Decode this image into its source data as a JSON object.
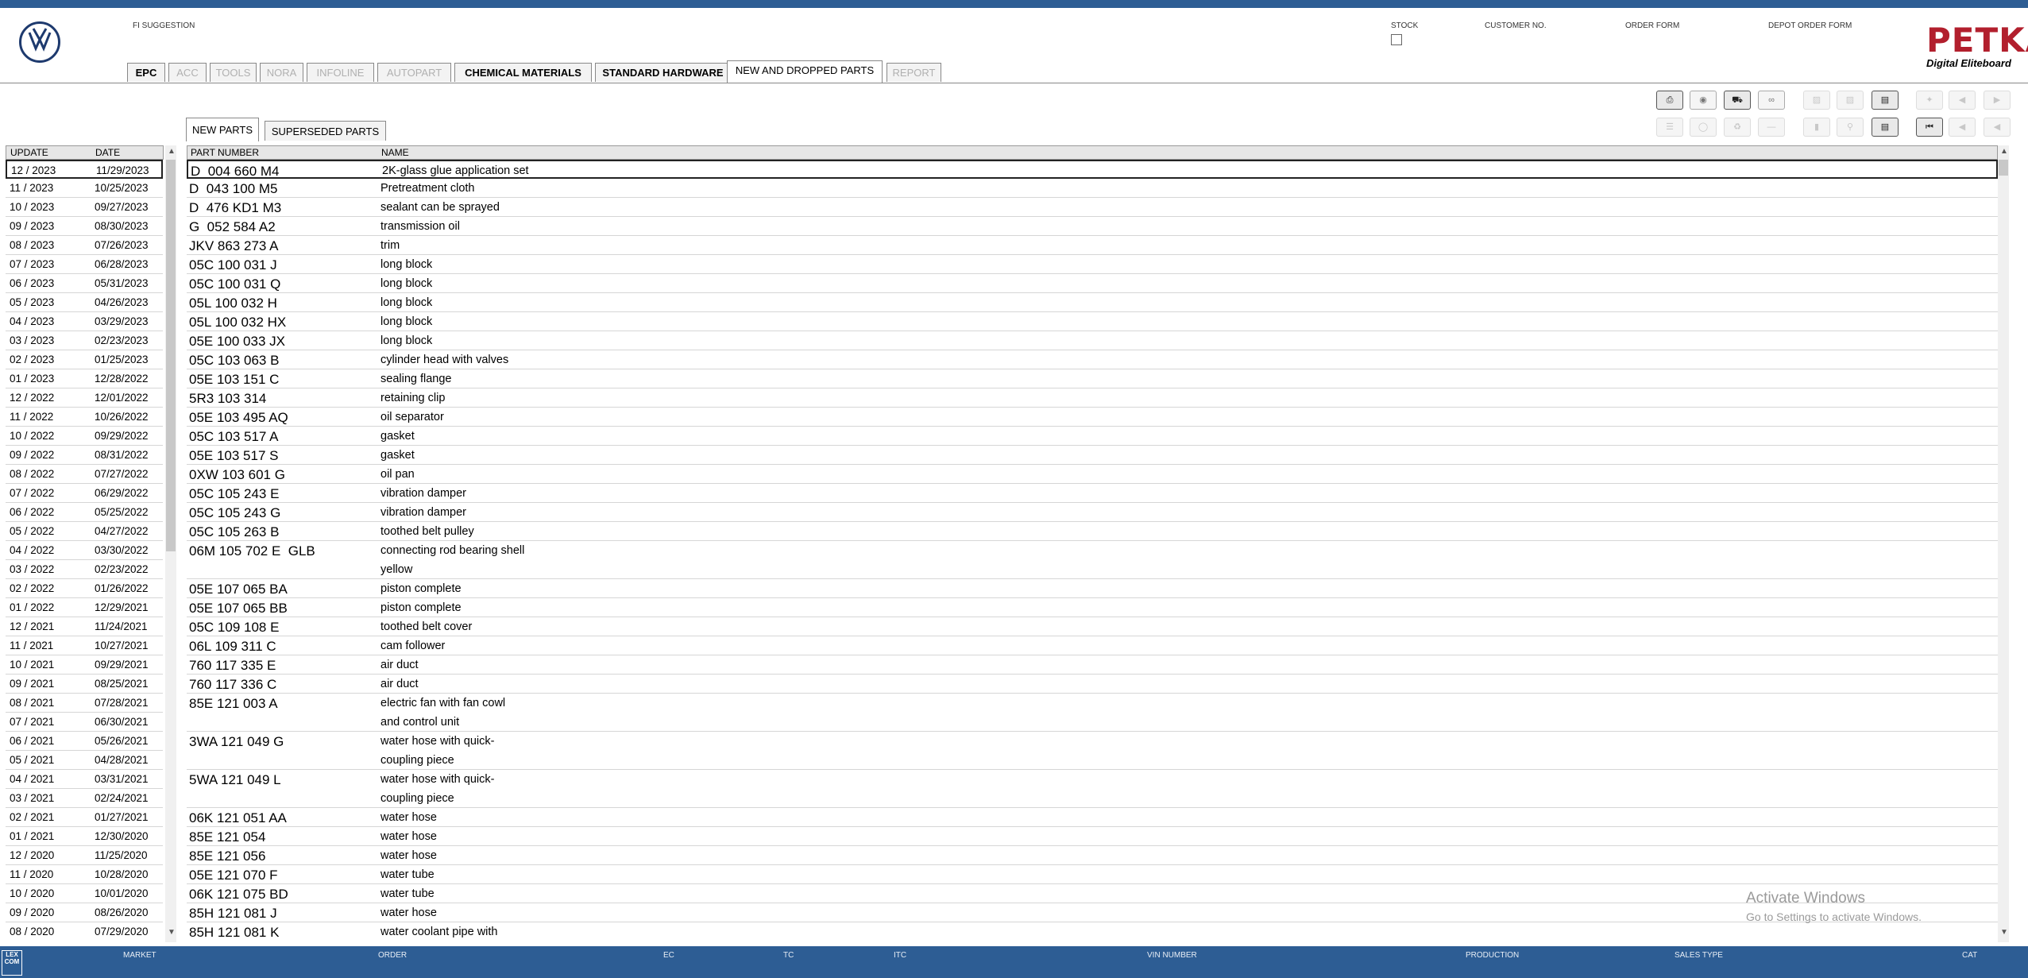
{
  "header": {
    "fi_suggestion": "FI SUGGESTION",
    "stock": "STOCK",
    "customer_no": "CUSTOMER NO.",
    "order_form": "ORDER FORM",
    "depot_order_form": "DEPOT ORDER FORM",
    "brand": "PETKA",
    "brand_sub": "Digital Eliteboard",
    "brand_color": "#b21f2d",
    "bar_color": "#2d5d94"
  },
  "tabs": [
    {
      "label": "EPC",
      "state": "enabled"
    },
    {
      "label": "ACC",
      "state": "disabled"
    },
    {
      "label": "TOOLS",
      "state": "disabled"
    },
    {
      "label": "NORA",
      "state": "disabled"
    },
    {
      "label": "INFOLINE",
      "state": "disabled"
    },
    {
      "label": "AUTOPART",
      "state": "disabled"
    },
    {
      "label": "CHEMICAL MATERIALS",
      "state": "enabled"
    },
    {
      "label": "STANDARD HARDWARE",
      "state": "enabled"
    },
    {
      "label": "NEW AND DROPPED PARTS",
      "state": "active"
    },
    {
      "label": "REPORT",
      "state": "disabled"
    }
  ],
  "toolbar": {
    "row1": [
      "print-icon",
      "stamp-icon",
      "car-icon",
      "glasses-icon",
      "sedan-icon",
      "coupe-icon",
      "cart-add-icon",
      "pin-icon",
      "page-prev-icon",
      "page-next-icon"
    ],
    "row2": [
      "list-icon",
      "key-icon",
      "recycle-icon",
      "minus-icon",
      "compare-icon",
      "search-doc-icon",
      "cart-icon",
      "first-icon",
      "prev-icon",
      "back-icon"
    ]
  },
  "subtabs": [
    {
      "label": "NEW PARTS",
      "active": true
    },
    {
      "label": "SUPERSEDED PARTS",
      "active": false
    }
  ],
  "left_table": {
    "headers": {
      "update": "UPDATE",
      "date": "DATE"
    },
    "rows": [
      {
        "update": "12 / 2023",
        "date": "11/29/2023"
      },
      {
        "update": "11 / 2023",
        "date": "10/25/2023"
      },
      {
        "update": "10 / 2023",
        "date": "09/27/2023"
      },
      {
        "update": "09 / 2023",
        "date": "08/30/2023"
      },
      {
        "update": "08 / 2023",
        "date": "07/26/2023"
      },
      {
        "update": "07 / 2023",
        "date": "06/28/2023"
      },
      {
        "update": "06 / 2023",
        "date": "05/31/2023"
      },
      {
        "update": "05 / 2023",
        "date": "04/26/2023"
      },
      {
        "update": "04 / 2023",
        "date": "03/29/2023"
      },
      {
        "update": "03 / 2023",
        "date": "02/23/2023"
      },
      {
        "update": "02 / 2023",
        "date": "01/25/2023"
      },
      {
        "update": "01 / 2023",
        "date": "12/28/2022"
      },
      {
        "update": "12 / 2022",
        "date": "12/01/2022"
      },
      {
        "update": "11 / 2022",
        "date": "10/26/2022"
      },
      {
        "update": "10 / 2022",
        "date": "09/29/2022"
      },
      {
        "update": "09 / 2022",
        "date": "08/31/2022"
      },
      {
        "update": "08 / 2022",
        "date": "07/27/2022"
      },
      {
        "update": "07 / 2022",
        "date": "06/29/2022"
      },
      {
        "update": "06 / 2022",
        "date": "05/25/2022"
      },
      {
        "update": "05 / 2022",
        "date": "04/27/2022"
      },
      {
        "update": "04 / 2022",
        "date": "03/30/2022"
      },
      {
        "update": "03 / 2022",
        "date": "02/23/2022"
      },
      {
        "update": "02 / 2022",
        "date": "01/26/2022"
      },
      {
        "update": "01 / 2022",
        "date": "12/29/2021"
      },
      {
        "update": "12 / 2021",
        "date": "11/24/2021"
      },
      {
        "update": "11 / 2021",
        "date": "10/27/2021"
      },
      {
        "update": "10 / 2021",
        "date": "09/29/2021"
      },
      {
        "update": "09 / 2021",
        "date": "08/25/2021"
      },
      {
        "update": "08 / 2021",
        "date": "07/28/2021"
      },
      {
        "update": "07 / 2021",
        "date": "06/30/2021"
      },
      {
        "update": "06 / 2021",
        "date": "05/26/2021"
      },
      {
        "update": "05 / 2021",
        "date": "04/28/2021"
      },
      {
        "update": "04 / 2021",
        "date": "03/31/2021"
      },
      {
        "update": "03 / 2021",
        "date": "02/24/2021"
      },
      {
        "update": "02 / 2021",
        "date": "01/27/2021"
      },
      {
        "update": "01 / 2021",
        "date": "12/30/2020"
      },
      {
        "update": "12 / 2020",
        "date": "11/25/2020"
      },
      {
        "update": "11 / 2020",
        "date": "10/28/2020"
      },
      {
        "update": "10 / 2020",
        "date": "10/01/2020"
      },
      {
        "update": "09 / 2020",
        "date": "08/26/2020"
      },
      {
        "update": "08 / 2020",
        "date": "07/29/2020"
      }
    ]
  },
  "main_table": {
    "headers": {
      "part_number": "PART NUMBER",
      "name": "NAME"
    },
    "rows": [
      {
        "part_number": "D  004 660 M4",
        "name": "2K-glass glue application set",
        "lines": 1
      },
      {
        "part_number": "D  043 100 M5",
        "name": "Pretreatment cloth",
        "lines": 1
      },
      {
        "part_number": "D  476 KD1 M3",
        "name": "sealant can be sprayed",
        "lines": 1
      },
      {
        "part_number": "G  052 584 A2",
        "name": "transmission oil",
        "lines": 1
      },
      {
        "part_number": "JKV 863 273 A",
        "name": "trim",
        "lines": 1
      },
      {
        "part_number": "05C 100 031 J",
        "name": "long block",
        "lines": 1
      },
      {
        "part_number": "05C 100 031 Q",
        "name": "long block",
        "lines": 1
      },
      {
        "part_number": "05L 100 032 H",
        "name": "long block",
        "lines": 1
      },
      {
        "part_number": "05L 100 032 HX",
        "name": "long block",
        "lines": 1
      },
      {
        "part_number": "05E 100 033 JX",
        "name": "long block",
        "lines": 1
      },
      {
        "part_number": "05C 103 063 B",
        "name": "cylinder head with valves",
        "lines": 1
      },
      {
        "part_number": "05E 103 151 C",
        "name": "sealing flange",
        "lines": 1
      },
      {
        "part_number": "5R3 103 314",
        "name": "retaining clip",
        "lines": 1
      },
      {
        "part_number": "05E 103 495 AQ",
        "name": "oil separator",
        "lines": 1
      },
      {
        "part_number": "05C 103 517 A",
        "name": "gasket",
        "lines": 1
      },
      {
        "part_number": "05E 103 517 S",
        "name": "gasket",
        "lines": 1
      },
      {
        "part_number": "0XW 103 601 G",
        "name": "oil pan",
        "lines": 1
      },
      {
        "part_number": "05C 105 243 E",
        "name": "vibration damper",
        "lines": 1
      },
      {
        "part_number": "05C 105 243 G",
        "name": "vibration damper",
        "lines": 1
      },
      {
        "part_number": "05C 105 263 B",
        "name": "toothed belt pulley",
        "lines": 1
      },
      {
        "part_number": "06M 105 702 E  GLB",
        "name": "connecting rod bearing shell",
        "name2": "yellow",
        "lines": 2
      },
      {
        "part_number": "05E 107 065 BA",
        "name": "piston complete",
        "lines": 1
      },
      {
        "part_number": "05E 107 065 BB",
        "name": "piston complete",
        "lines": 1
      },
      {
        "part_number": "05C 109 108 E",
        "name": "toothed belt cover",
        "lines": 1
      },
      {
        "part_number": "06L 109 311 C",
        "name": "cam follower",
        "lines": 1
      },
      {
        "part_number": "760 117 335 E",
        "name": "air duct",
        "lines": 1
      },
      {
        "part_number": "760 117 336 C",
        "name": "air duct",
        "lines": 1
      },
      {
        "part_number": "85E 121 003 A",
        "name": "electric fan with fan cowl",
        "name2": "and control unit",
        "lines": 2
      },
      {
        "part_number": "3WA 121 049 G",
        "name": "water hose with quick-",
        "name2": "coupling piece",
        "lines": 2
      },
      {
        "part_number": "5WA 121 049 L",
        "name": "water hose with quick-",
        "name2": "coupling piece",
        "lines": 2
      },
      {
        "part_number": "06K 121 051 AA",
        "name": "water hose",
        "lines": 1
      },
      {
        "part_number": "85E 121 054",
        "name": "water hose",
        "lines": 1
      },
      {
        "part_number": "85E 121 056",
        "name": "water hose",
        "lines": 1
      },
      {
        "part_number": "05E 121 070 F",
        "name": "water tube",
        "lines": 1
      },
      {
        "part_number": "06K 121 075 BD",
        "name": "water tube",
        "lines": 1
      },
      {
        "part_number": "85H 121 081 J",
        "name": "water hose",
        "lines": 1
      },
      {
        "part_number": "85H 121 081 K",
        "name": "water coolant pipe with",
        "lines": 1
      }
    ]
  },
  "watermark": {
    "line1": "Activate Windows",
    "line2": "Go to Settings to activate Windows."
  },
  "footer": {
    "logo": "LEX\nCOM",
    "labels": [
      "MARKET",
      "ORDER",
      "EC",
      "TC",
      "ITC",
      "VIN NUMBER",
      "PRODUCTION",
      "SALES TYPE",
      "CAT"
    ]
  }
}
